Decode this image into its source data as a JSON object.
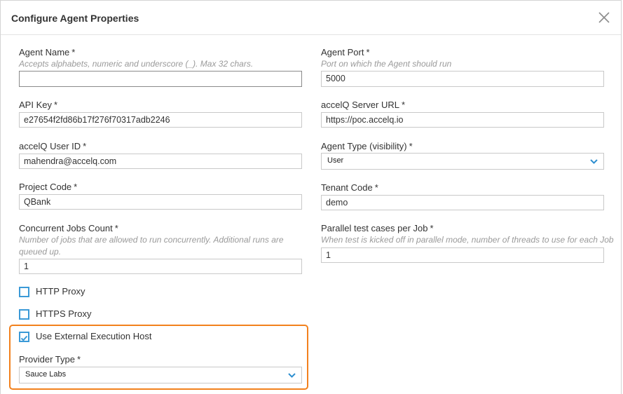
{
  "dialog": {
    "title": "Configure Agent Properties",
    "close_icon": "close-x-icon"
  },
  "fields": {
    "agent_name": {
      "label": "Agent Name",
      "required": "*",
      "hint": "Accepts alphabets, numeric and underscore (_). Max 32 chars.",
      "value": ""
    },
    "agent_port": {
      "label": "Agent Port",
      "required": "*",
      "hint": "Port on which the Agent should run",
      "value": "5000"
    },
    "api_key": {
      "label": "API Key",
      "required": "*",
      "value": "e27654f2fd86b17f276f70317adb2246"
    },
    "server_url": {
      "label": "accelQ Server URL",
      "required": "*",
      "value": "https://poc.accelq.io"
    },
    "user_id": {
      "label": "accelQ User ID",
      "required": "*",
      "value": "mahendra@accelq.com"
    },
    "agent_type": {
      "label": "Agent Type (visibility)",
      "required": "*",
      "value": "User"
    },
    "project_code": {
      "label": "Project Code",
      "required": "*",
      "value": "QBank"
    },
    "tenant_code": {
      "label": "Tenant Code",
      "required": "*",
      "value": "demo"
    },
    "concurrent_jobs": {
      "label": "Concurrent Jobs Count",
      "required": "*",
      "hint_line1": "Number of jobs that are allowed to run concurrently. Additional runs are",
      "hint_line2": "queued up.",
      "value": "1"
    },
    "parallel_tests": {
      "label": "Parallel test cases per Job",
      "required": "*",
      "hint": "When test is kicked off in parallel mode, number of threads to use for each Job",
      "value": "1"
    },
    "provider_type": {
      "label": "Provider Type",
      "required": "*",
      "value": "Sauce Labs"
    }
  },
  "checkboxes": {
    "http_proxy": {
      "label": "HTTP Proxy",
      "checked": false
    },
    "https_proxy": {
      "label": "HTTPS Proxy",
      "checked": false
    },
    "external_host": {
      "label": "Use External Execution Host",
      "checked": true
    }
  },
  "colors": {
    "accent": "#3b9ad7",
    "highlight": "#f2811d",
    "hint": "#9a9a9a"
  }
}
